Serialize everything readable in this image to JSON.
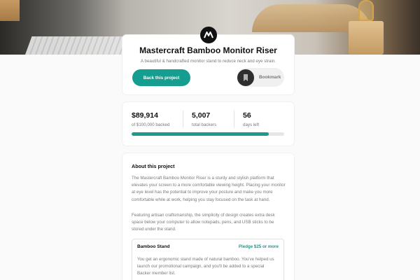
{
  "hero": {
    "image": "product-hero-photo"
  },
  "logo": {
    "icon": "mastercraft-logo-icon",
    "glyph": "M"
  },
  "product": {
    "title": "Mastercraft Bamboo Monitor Riser",
    "subtitle": "A beautiful & handcrafted monitor stand to reduce neck and eye strain."
  },
  "actions": {
    "back_label": "Back this project",
    "bookmark_label": "Bookmark",
    "bookmark_icon": "bookmark-icon"
  },
  "stats": {
    "backed_amount": "$89,914",
    "backed_label": "of $100,000 backed",
    "backers_count": "5,007",
    "backers_label": "total backers",
    "days_count": "56",
    "days_label": "days left",
    "progress_fraction": 0.899
  },
  "about": {
    "heading": "About this project",
    "paragraph1": "The Mastercraft Bamboo Monitor Riser is a sturdy and stylish platform that elevates your screen to a more comfortable viewing height. Placing your monitor at eye level has the potential to improve your posture and make you more comfortable while at work, helping you stay focused on the task at hand.",
    "paragraph2": "Featuring artisan craftsmanship, the simplicity of design creates extra desk space below your computer to allow notepads, pens, and USB sticks to be stored under the stand."
  },
  "pledge": {
    "name": "Bamboo Stand",
    "amount": "Pledge $25 or more",
    "description": "You get an ergonomic stand made of natural bamboo. You've helped us launch our promotional campaign, and you'll be added to a special Backer member list."
  },
  "colors": {
    "accent": "#159d8f",
    "background": "#fafafa",
    "card": "#ffffff",
    "muted_text": "#7a7a7a"
  }
}
